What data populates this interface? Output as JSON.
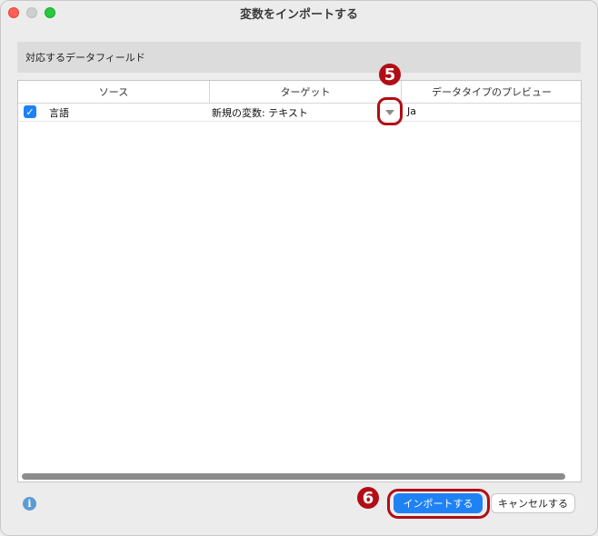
{
  "window": {
    "title": "変数をインポートする"
  },
  "section": {
    "title": "対応するデータフィールド"
  },
  "table": {
    "columns": [
      "ソース",
      "ターゲット",
      "データタイプのプレビュー"
    ],
    "rows": [
      {
        "checked": true,
        "source": "言語",
        "target": "新規の変数: テキスト",
        "preview": "Ja"
      }
    ]
  },
  "annotations": {
    "step5": "5",
    "step6": "6"
  },
  "buttons": {
    "import": "インポートする",
    "cancel": "キャンセルする"
  },
  "icons": {
    "checkbox": "checkmark-icon",
    "dropdown": "chevron-down-icon",
    "info": "info-icon"
  },
  "colors": {
    "accent": "#1e82f4",
    "callout": "#b20d16"
  }
}
